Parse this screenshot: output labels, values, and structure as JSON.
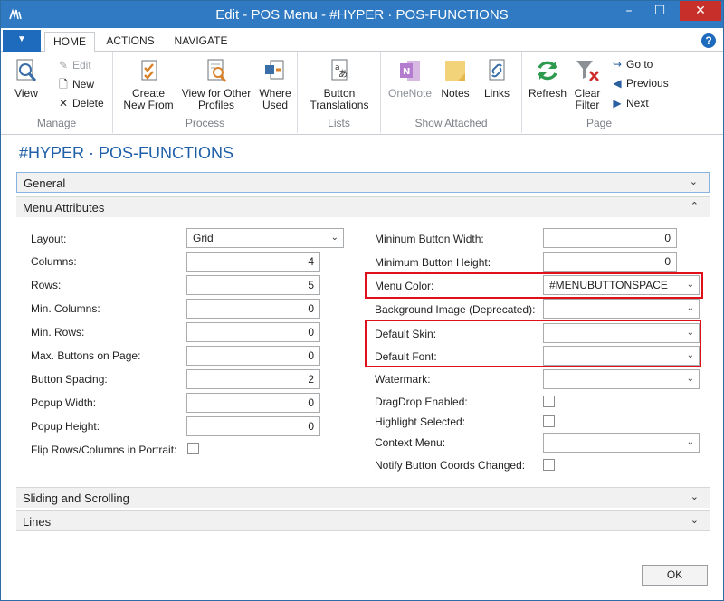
{
  "window": {
    "title": "Edit - POS Menu - #HYPER · POS-FUNCTIONS",
    "minimize": "–",
    "maximize": "☐",
    "close": "✕"
  },
  "ribbon_tabs": [
    "HOME",
    "ACTIONS",
    "NAVIGATE"
  ],
  "help": "?",
  "ribbon": {
    "manage": {
      "label": "Manage",
      "view": "View",
      "edit": "Edit",
      "new": "New",
      "delete": "Delete"
    },
    "process": {
      "label": "Process",
      "create_new_from": [
        "Create",
        "New From"
      ],
      "view_other_profiles": [
        "View for Other",
        "Profiles"
      ],
      "where_used": [
        "Where",
        "Used"
      ]
    },
    "lists": {
      "label": "Lists",
      "button_translations": [
        "Button",
        "Translations"
      ]
    },
    "show_attached": {
      "label": "Show Attached",
      "onenote": "OneNote",
      "notes": "Notes",
      "links": "Links"
    },
    "page": {
      "label": "Page",
      "refresh": "Refresh",
      "clear_filter": [
        "Clear",
        "Filter"
      ],
      "go_to": "Go to",
      "previous": "Previous",
      "next": "Next"
    }
  },
  "page_title": "#HYPER · POS-FUNCTIONS",
  "fasttabs": {
    "general": "General",
    "menu_attributes": "Menu Attributes",
    "sliding": "Sliding and Scrolling",
    "lines": "Lines"
  },
  "left_fields": {
    "layout": {
      "label": "Layout:",
      "value": "Grid"
    },
    "columns": {
      "label": "Columns:",
      "value": "4"
    },
    "rows": {
      "label": "Rows:",
      "value": "5"
    },
    "min_columns": {
      "label": "Min. Columns:",
      "value": "0"
    },
    "min_rows": {
      "label": "Min. Rows:",
      "value": "0"
    },
    "max_buttons": {
      "label": "Max. Buttons on Page:",
      "value": "0"
    },
    "button_spacing": {
      "label": "Button Spacing:",
      "value": "2"
    },
    "popup_width": {
      "label": "Popup Width:",
      "value": "0"
    },
    "popup_height": {
      "label": "Popup Height:",
      "value": "0"
    },
    "flip_rows": {
      "label": "Flip Rows/Columns in Portrait:",
      "checked": false
    }
  },
  "right_fields": {
    "min_button_width": {
      "label": "Mininum Button Width:",
      "value": "0"
    },
    "min_button_height": {
      "label": "Minimum Button Height:",
      "value": "0"
    },
    "menu_color": {
      "label": "Menu Color:",
      "value": "#MENUBUTTONSPACE"
    },
    "background_image": {
      "label": "Background Image (Deprecated):",
      "value": ""
    },
    "default_skin": {
      "label": "Default Skin:",
      "value": ""
    },
    "default_font": {
      "label": "Default Font:",
      "value": ""
    },
    "watermark": {
      "label": "Watermark:",
      "value": ""
    },
    "dragdrop": {
      "label": "DragDrop Enabled:",
      "checked": false
    },
    "highlight_selected": {
      "label": "Highlight Selected:",
      "checked": false
    },
    "context_menu": {
      "label": "Context Menu:",
      "value": ""
    },
    "notify_coords": {
      "label": "Notify Button Coords Changed:",
      "checked": false
    }
  },
  "ok_label": "OK",
  "colors": {
    "titlebar": "#2f7ac2",
    "accent": "#1f5fa8",
    "highlight": "#e0101a"
  }
}
